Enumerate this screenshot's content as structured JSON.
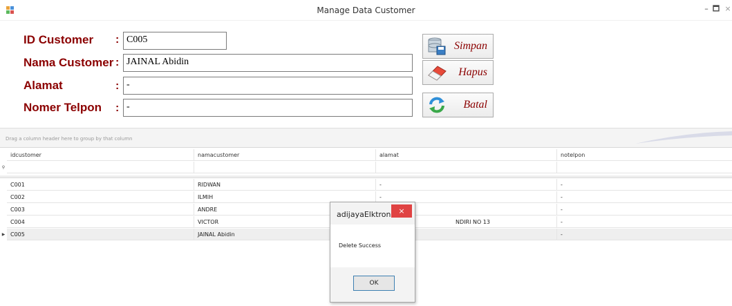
{
  "window": {
    "title": "Manage Data Customer",
    "min": "–",
    "max": "🗖",
    "close": "×"
  },
  "form": {
    "id_label": "ID Customer",
    "nama_label": "Nama Customer",
    "alamat_label": "Alamat",
    "telpon_label": "Nomer Telpon",
    "colon": ":",
    "id_value": "C005",
    "nama_value": "JAINAL Abidin",
    "alamat_value": "-",
    "telpon_value": "-"
  },
  "buttons": {
    "simpan": "Simpan",
    "hapus": "Hapus",
    "batal": "Batal"
  },
  "grid": {
    "group_hint": "Drag a column header here to group by that column",
    "headers": [
      "idcustomer",
      "namacustomer",
      "alamat",
      "notelpon"
    ],
    "rows": [
      [
        "C001",
        "RIDWAN",
        "-",
        "-"
      ],
      [
        "C002",
        "ILMIH",
        "-",
        "-"
      ],
      [
        "C003",
        "ANDRE",
        "",
        "-"
      ],
      [
        "C004",
        "VICTOR",
        "NDIRI NO 13",
        "-"
      ],
      [
        "C005",
        "JAINAL Abidin",
        "",
        "-"
      ]
    ]
  },
  "dialog": {
    "title": "adijayaElktronik",
    "message": "Delete Success",
    "ok": "OK",
    "close": "×"
  },
  "colors": {
    "label": "#8b0000",
    "close_red": "#e04343"
  }
}
